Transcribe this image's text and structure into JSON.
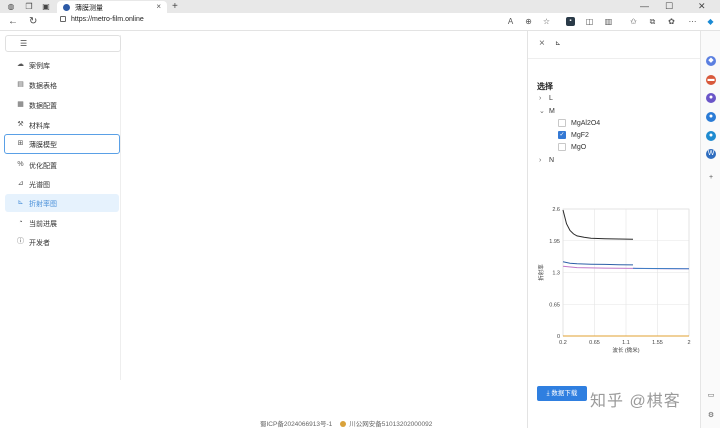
{
  "browser": {
    "tab_title": "薄膜测量",
    "url": "https://metro-film.online",
    "tab_close": "×",
    "new_tab": "+"
  },
  "sidebar": {
    "toggle_icon": "☰",
    "items": [
      {
        "label": "案例库",
        "icon": "cloud-icon"
      },
      {
        "label": "数据表格",
        "icon": "table-icon"
      },
      {
        "label": "数据配置",
        "icon": "grid-icon"
      },
      {
        "label": "材料库",
        "icon": "hammer-icon"
      },
      {
        "label": "薄膜模型",
        "icon": "layers-icon"
      },
      {
        "label": "优化配置",
        "icon": "percent-icon"
      },
      {
        "label": "光谱图",
        "icon": "line-chart-icon"
      },
      {
        "label": "折射率图",
        "icon": "area-chart-icon"
      },
      {
        "label": "当前进展",
        "icon": "progress-icon"
      },
      {
        "label": "开发者",
        "icon": "info-icon"
      }
    ],
    "focused_index": 4,
    "active_index": 7
  },
  "drawer": {
    "close_icon": "×",
    "chart_icon_label": "⊾",
    "select_title": "选择",
    "tree": [
      {
        "key": "L",
        "expanded": false
      },
      {
        "key": "M",
        "expanded": true,
        "children": [
          {
            "label": "MgAl2O4",
            "checked": false
          },
          {
            "label": "MgF2",
            "checked": true
          },
          {
            "label": "MgO",
            "checked": false
          }
        ]
      },
      {
        "key": "N",
        "expanded": false
      }
    ],
    "download_label": "数据下载",
    "download_icon": "download-icon"
  },
  "chart_data": {
    "type": "line",
    "xlabel": "波长 (微米)",
    "ylabel": "折射率",
    "xlim": [
      0.2,
      2
    ],
    "ylim": [
      0,
      2.6
    ],
    "xticks": [
      "0.2",
      "0.65",
      "1.1",
      "1.55",
      "2"
    ],
    "yticks": [
      "0",
      "0.65",
      "1.3",
      "1.95",
      "2.6"
    ],
    "grid": true,
    "series": [
      {
        "color": "#2b2b2b",
        "x": [
          0.2,
          0.25,
          0.3,
          0.35,
          0.4,
          0.5,
          0.6,
          0.8,
          1.0,
          1.2
        ],
        "y": [
          2.58,
          2.3,
          2.16,
          2.09,
          2.05,
          2.02,
          2.0,
          1.99,
          1.985,
          1.98
        ]
      },
      {
        "color": "#2d5fa8",
        "x": [
          0.2,
          0.3,
          0.4,
          0.6,
          0.8,
          1.0,
          1.2
        ],
        "y": [
          1.52,
          1.49,
          1.48,
          1.47,
          1.465,
          1.46,
          1.455
        ]
      },
      {
        "color": "#c079c9",
        "x": [
          0.2,
          0.4,
          0.6,
          0.8,
          1.0,
          1.2,
          1.5,
          1.8,
          2.0
        ],
        "y": [
          1.43,
          1.4,
          1.395,
          1.39,
          1.385,
          1.383,
          1.38,
          1.378,
          1.378
        ]
      },
      {
        "color": "#3c7dc4",
        "x": [
          1.2,
          1.5,
          1.8,
          2.0
        ],
        "y": [
          1.385,
          1.382,
          1.38,
          1.378
        ]
      },
      {
        "color": "#e0a030",
        "x": [
          0.2,
          0.6,
          1.0,
          1.4,
          1.8,
          2.0
        ],
        "y": [
          0.0,
          0.0,
          0.0,
          0.0,
          0.0,
          0.0
        ]
      }
    ]
  },
  "footer": {
    "icp": "蜀ICP备2024066913号-1",
    "police": "川公网安备51013202000092"
  },
  "watermark": "知乎 @棋客"
}
